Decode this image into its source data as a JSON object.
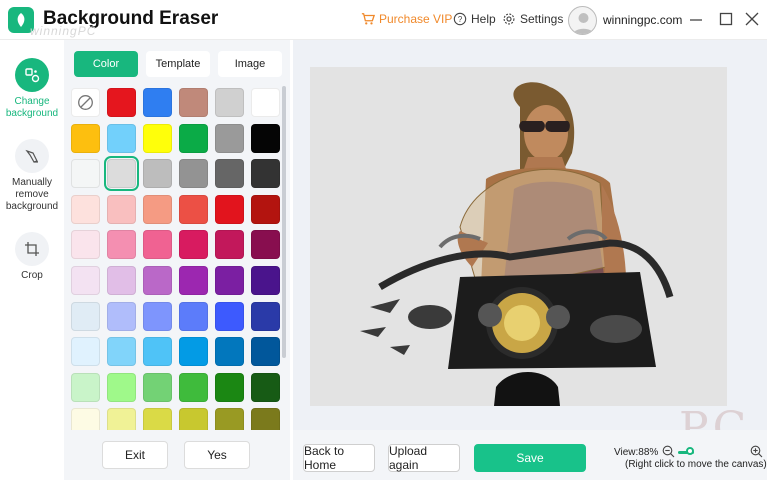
{
  "app": {
    "title": "Background Eraser",
    "watermark": "winningPC"
  },
  "header": {
    "purchase_vip": "Purchase VIP",
    "help": "Help",
    "settings": "Settings",
    "username": "winningpc.com"
  },
  "rail": {
    "change_background": "Change background",
    "manually_remove": "Manually remove background",
    "crop": "Crop"
  },
  "panel": {
    "tabs": [
      "Color",
      "Template",
      "Image"
    ],
    "active_tab": "Color",
    "exit_label": "Exit",
    "yes_label": "Yes"
  },
  "swatches": [
    [
      "none",
      "#e5161e",
      "#2f7ef1",
      "#c0897a",
      "#d0d0d0",
      "#ffffff"
    ],
    [
      "#fdbf0f",
      "#72d0fb",
      "#ffff0a",
      "#0bab47",
      "#9a9a9a",
      "#050505"
    ],
    [
      "#f4f6f6",
      "#dcdcdc",
      "#bdbdbd",
      "#939393",
      "#666666",
      "#333333"
    ],
    [
      "#fde1dd",
      "#f9bfbf",
      "#f59b83",
      "#ec5045",
      "#e2141d",
      "#b3140f"
    ],
    [
      "#fae4ec",
      "#f48fb1",
      "#f06292",
      "#d81b60",
      "#c2185b",
      "#880e4f"
    ],
    [
      "#f3e2f2",
      "#e1bee7",
      "#ba68c8",
      "#9c27b0",
      "#7b1fa2",
      "#4a148c"
    ],
    [
      "#e0ecf5",
      "#b0bdfb",
      "#7e95fd",
      "#5c7cfa",
      "#3d5afe",
      "#2a3aa8"
    ],
    [
      "#e0f2fe",
      "#81d4fa",
      "#4fc3f7",
      "#039be5",
      "#0277bd",
      "#01579b"
    ],
    [
      "#c9f4c9",
      "#9ff98a",
      "#73d275",
      "#3fbb3c",
      "#1b8713",
      "#175b15"
    ],
    [
      "#fdfbe4",
      "#f0f296",
      "#dada46",
      "#c8c82f",
      "#999a23",
      "#7b7a1c"
    ]
  ],
  "selected_swatch": "#dcdcdc",
  "bottom": {
    "back_home": "Back to Home",
    "upload_again": "Upload again",
    "save": "Save",
    "view": "View:88%",
    "hint": "(Right click to move the canvas)"
  },
  "colors": {
    "accent": "#18b77e",
    "vip": "#f0892b"
  }
}
